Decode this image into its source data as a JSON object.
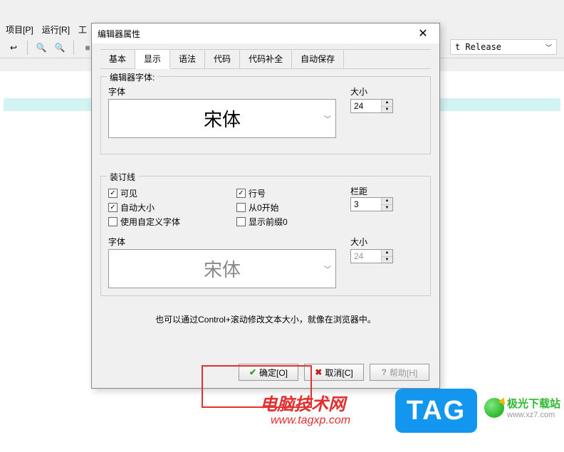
{
  "bg_menu": {
    "items": [
      "项目[P]",
      "运行[R]",
      "工"
    ]
  },
  "bg_release": "t Release",
  "dialog": {
    "title": "编辑器属性",
    "tabs": [
      "基本",
      "显示",
      "语法",
      "代码",
      "代码补全",
      "自动保存"
    ],
    "active_tab": 1,
    "editor_font_group": {
      "title": "编辑器字体:",
      "font_label": "字体",
      "font_value": "宋体",
      "size_label": "大小",
      "size_value": "24"
    },
    "gutter_group": {
      "title": "装订线",
      "visible": "可见",
      "auto_size": "自动大小",
      "custom_font": "使用自定义字体",
      "line_no": "行号",
      "from_zero": "从0开始",
      "leading_zero": "显示前缀0",
      "spacing_label": "栏距",
      "spacing_value": "3",
      "font_label": "字体",
      "font_value": "宋体",
      "size_label": "大小",
      "size_value": "24"
    },
    "hint": "也可以通过Control+滚动修改文本大小，就像在浏览器中。",
    "buttons": {
      "ok": "确定[O]",
      "cancel": "取消[C]",
      "help": "帮助[H]"
    }
  },
  "watermark": {
    "title": "电脑技术网",
    "url": "www.tagxp.com",
    "tag": "TAG",
    "jg_name": "极光下载站",
    "jg_url": "www.xz7.com"
  }
}
